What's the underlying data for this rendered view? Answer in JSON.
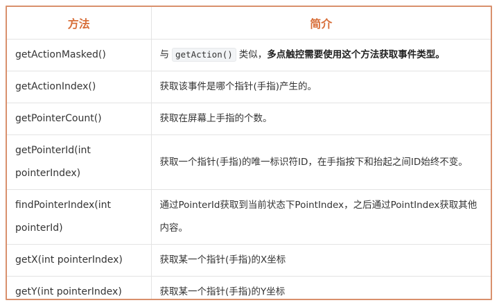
{
  "headers": {
    "method": "方法",
    "desc": "简介"
  },
  "rows": [
    {
      "method": "getActionMasked()",
      "desc_prefix": "与",
      "desc_code": "getAction()",
      "desc_mid": "类似，",
      "desc_bold": "多点触控需要使用这个方法获取事件类型。"
    },
    {
      "method": "getActionIndex()",
      "desc": "获取该事件是哪个指针(手指)产生的。"
    },
    {
      "method": "getPointerCount()",
      "desc": "获取在屏幕上手指的个数。"
    },
    {
      "method": "getPointerId(int pointerIndex)",
      "desc": "获取一个指针(手指)的唯一标识符ID，在手指按下和抬起之间ID始终不变。"
    },
    {
      "method": "findPointerIndex(int pointerId)",
      "desc": "通过PointerId获取到当前状态下PointIndex，之后通过PointIndex获取其他内容。"
    },
    {
      "method": "getX(int pointerIndex)",
      "desc": "获取某一个指针(手指)的X坐标"
    },
    {
      "method": "getY(int pointerIndex)",
      "desc": "获取某一个指针(手指)的Y坐标"
    }
  ]
}
